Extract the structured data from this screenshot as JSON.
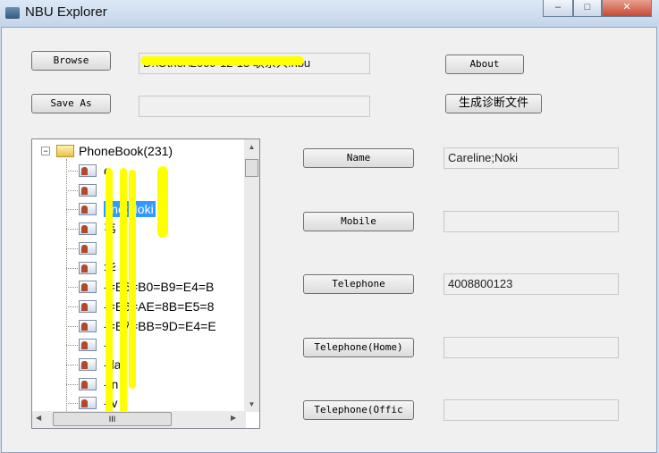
{
  "window": {
    "title": "NBU Explorer",
    "minimize": "–",
    "maximize": "□",
    "close": "✕"
  },
  "file": {
    "browse_label": "Browse",
    "path_value": "D:\\Other\\2009-12-13 联系人.nbu",
    "save_as_label": "Save As",
    "save_path_value": ""
  },
  "actions": {
    "about_label": "About",
    "diagnose_label": "生成诊断文件"
  },
  "tree": {
    "root_label": "PhoneBook(231)",
    "items": [
      "e",
      "",
      "line;Noki",
      "韦",
      "",
      "华",
      "-=E5=B0=B9=E4=B",
      "-=E6=AE=8B=E5=8",
      "-=E7=BB=9D=E4=E",
      "-",
      "- la",
      "- n",
      "- v"
    ],
    "selected_index": 2,
    "scroll_thumb": "III"
  },
  "fields": [
    {
      "label": "Name",
      "value": "Careline;Noki"
    },
    {
      "label": "Mobile",
      "value": ""
    },
    {
      "label": "Telephone",
      "value": "4008800123"
    },
    {
      "label": "Telephone(Home)",
      "value": ""
    },
    {
      "label": "Telephone(Offic",
      "value": ""
    }
  ],
  "colors": {
    "selection": "#3399ff",
    "redaction": "#ffff00"
  }
}
